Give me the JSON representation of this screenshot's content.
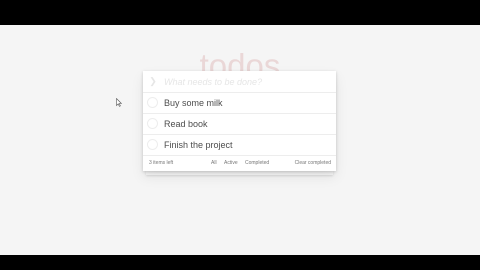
{
  "app": {
    "title": "todos",
    "new_todo_placeholder": "What needs to be done?",
    "toggle_all_icon": "chevron-down-icon"
  },
  "todos": [
    {
      "label": "Buy some milk",
      "completed": false
    },
    {
      "label": "Read book",
      "completed": false
    },
    {
      "label": "Finish the project",
      "completed": false
    }
  ],
  "footer": {
    "count_text": "3 items left",
    "filters": [
      {
        "label": "All",
        "selected": true
      },
      {
        "label": "Active",
        "selected": false
      },
      {
        "label": "Completed",
        "selected": false
      }
    ],
    "clear_label": "Clear completed"
  },
  "colors": {
    "background": "#f5f5f5",
    "title": "#ead7d7",
    "text": "#4d4d4d",
    "placeholder": "#e6e6e6"
  }
}
